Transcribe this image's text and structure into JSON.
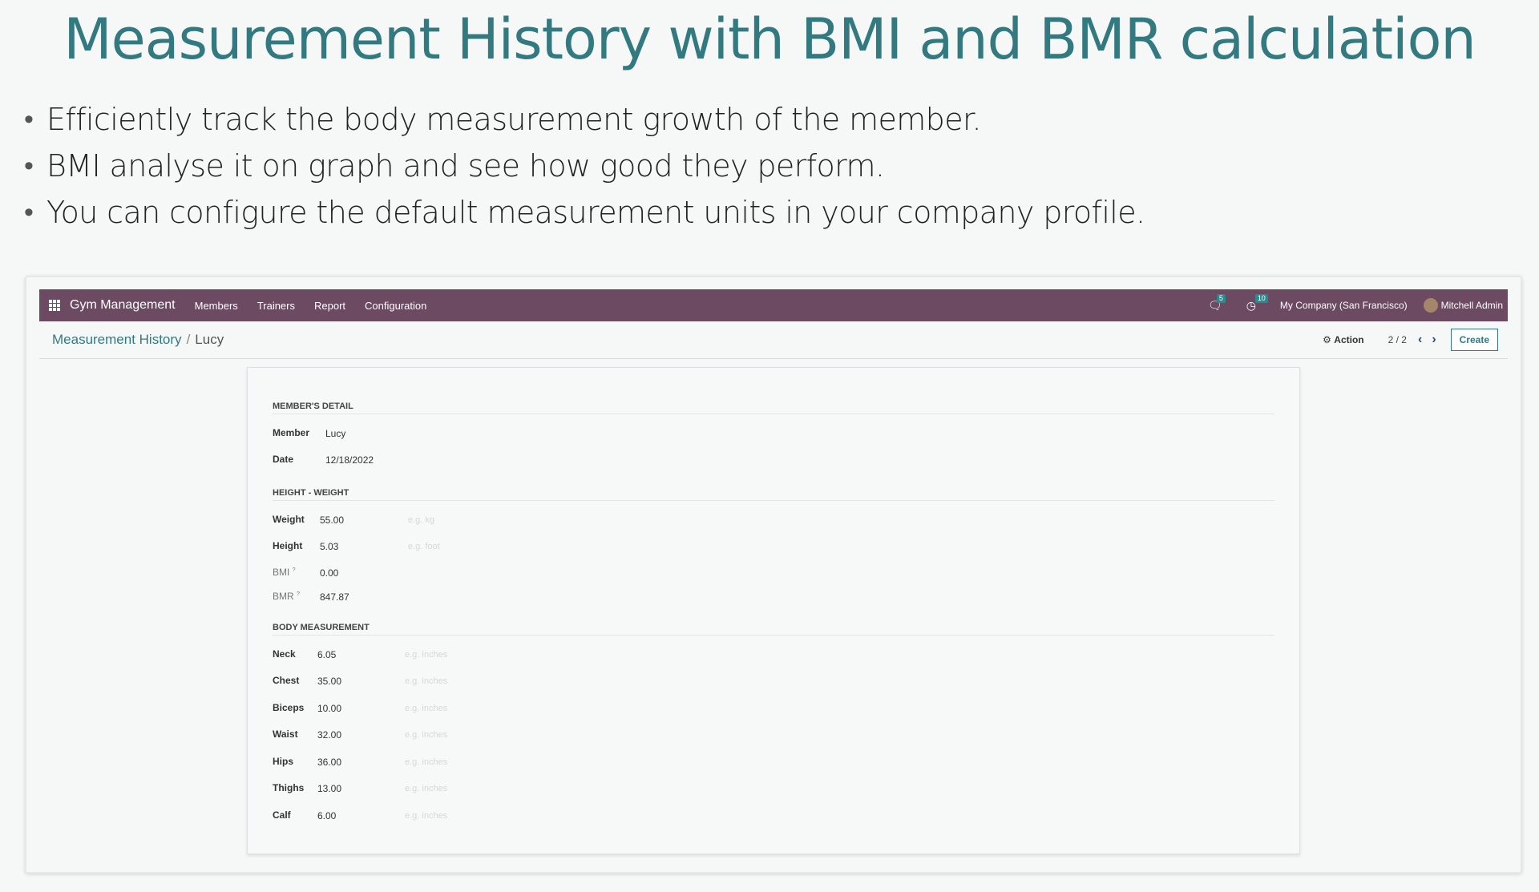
{
  "heading": "Measurement History with BMI and BMR calculation",
  "bullets": [
    "Efficiently track the body measurement growth of the member.",
    "BMI analyse it on graph and see how good they perform.",
    "You can configure the default measurement units in your company profile."
  ],
  "navbar": {
    "app_name": "Gym Management",
    "menu": [
      "Members",
      "Trainers",
      "Report",
      "Configuration"
    ],
    "messages_count": "5",
    "activities_count": "10",
    "company": "My Company (San Francisco)",
    "user": "Mitchell Admin",
    "color": "#6b4a62"
  },
  "control_panel": {
    "breadcrumb_parent": "Measurement History",
    "breadcrumb_sep": "/",
    "breadcrumb_current": "Lucy",
    "action_label": "Action",
    "pager": "2 / 2",
    "create_label": "Create"
  },
  "form": {
    "members_detail": {
      "title": "MEMBER'S DETAIL",
      "member_label": "Member",
      "member_value": "Lucy",
      "date_label": "Date",
      "date_value": "12/18/2022"
    },
    "height_weight": {
      "title": "HEIGHT - WEIGHT",
      "weight_label": "Weight",
      "weight_value": "55.00",
      "weight_placeholder": "e.g. kg",
      "height_label": "Height",
      "height_value": "5.03",
      "height_placeholder": "e.g. foot",
      "bmi_label": "BMI",
      "bmi_value": "0.00",
      "bmr_label": "BMR",
      "bmr_value": "847.87",
      "help_marker": "?"
    },
    "body_measurement": {
      "title": "BODY MEASUREMENT",
      "placeholder": "e.g. inches",
      "rows": [
        {
          "label": "Neck",
          "value": "6.05"
        },
        {
          "label": "Chest",
          "value": "35.00"
        },
        {
          "label": "Biceps",
          "value": "10.00"
        },
        {
          "label": "Waist",
          "value": "32.00"
        },
        {
          "label": "Hips",
          "value": "36.00"
        },
        {
          "label": "Thighs",
          "value": "13.00"
        },
        {
          "label": "Calf",
          "value": "6.00"
        }
      ]
    }
  },
  "colors": {
    "accent": "#337a80",
    "navbar": "#6b4a62"
  }
}
